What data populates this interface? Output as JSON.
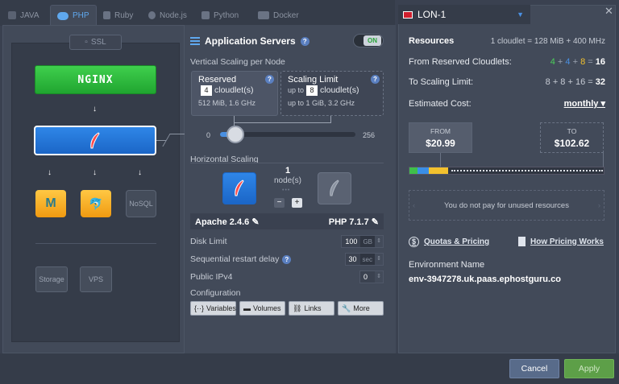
{
  "tabs": [
    {
      "label": "JAVA"
    },
    {
      "label": "PHP"
    },
    {
      "label": "Ruby"
    },
    {
      "label": "Node.js"
    },
    {
      "label": "Python"
    },
    {
      "label": "Docker"
    }
  ],
  "topology": {
    "ssl": "SSL",
    "balancer": "NGINX",
    "nosql": "NoSQL",
    "storage": "Storage",
    "vps": "VPS"
  },
  "app": {
    "title": "Application Servers",
    "toggle": "ON"
  },
  "vertical": {
    "label": "Vertical Scaling per Node",
    "reserved_title": "Reserved",
    "reserved_value": "4",
    "reserved_unit": "cloudlet(s)",
    "reserved_spec": "512 MiB, 1.6 GHz",
    "limit_title": "Scaling Limit",
    "limit_prefix": "up to",
    "limit_value": "8",
    "limit_unit": "cloudlet(s)",
    "limit_spec": "up to 1 GiB, 3.2 GHz",
    "slider_min": "0",
    "slider_max": "256",
    "slider_reserved": 4,
    "slider_limit": 8
  },
  "horizontal": {
    "label": "Horizontal Scaling",
    "count": "1",
    "unit": "node(s)",
    "minus": "−",
    "plus": "+"
  },
  "versions": {
    "server": "Apache 2.4.6",
    "php": "PHP 7.1.7"
  },
  "settings": {
    "disk_label": "Disk Limit",
    "disk_value": "100",
    "disk_unit": "GB",
    "restart_label": "Sequential restart delay",
    "restart_value": "30",
    "restart_unit": "sec",
    "ipv4_label": "Public IPv4",
    "ipv4_value": "0"
  },
  "config": {
    "label": "Configuration",
    "buttons": [
      "Variables",
      "Volumes",
      "Links",
      "More"
    ]
  },
  "right": {
    "region": "LON-1",
    "resources_label": "Resources",
    "resources_value": "1 cloudlet = 128 MiB + 400 MHz",
    "reserved_label": "From Reserved Cloudlets:",
    "reserved_terms": [
      "4",
      "4",
      "8"
    ],
    "reserved_total": "16",
    "limit_label": "To Scaling Limit:",
    "limit_formula": "8 + 8 + 16 = ",
    "limit_total": "32",
    "cost_label": "Estimated Cost:",
    "cost_period": "monthly",
    "from_label": "FROM",
    "from_value": "$20.99",
    "to_label": "TO",
    "to_value": "$102.62",
    "note": "You do not pay for unused resources",
    "quotas": "Quotas & Pricing",
    "how": "How Pricing Works",
    "env_label": "Environment Name",
    "env_value": "env-3947278.uk.paas.ephostguru.co"
  },
  "footer": {
    "cancel": "Cancel",
    "apply": "Apply"
  },
  "colors": {
    "accent": "#4a90e2",
    "green": "#2aa43a",
    "apply": "#5d9f48"
  }
}
